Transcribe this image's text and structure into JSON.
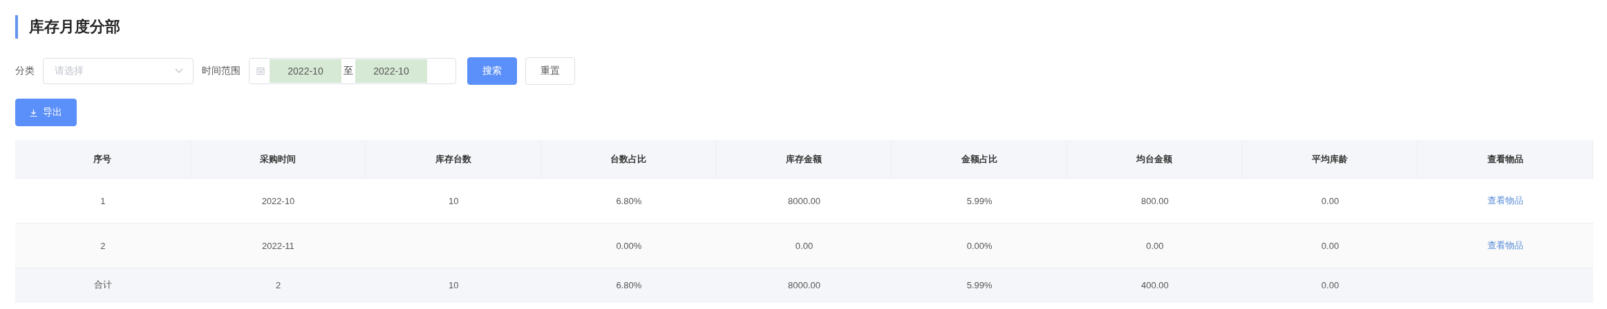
{
  "title": "库存月度分部",
  "filters": {
    "category_label": "分类",
    "category_placeholder": "请选择",
    "range_label": "时间范围",
    "range_start": "2022-10",
    "range_separator": "至",
    "range_end": "2022-10"
  },
  "buttons": {
    "search": "搜索",
    "reset": "重置",
    "export": "导出"
  },
  "table": {
    "columns": [
      "序号",
      "采购时间",
      "库存台数",
      "台数占比",
      "库存金额",
      "金额占比",
      "均台金额",
      "平均库龄",
      "查看物品"
    ],
    "rows": [
      {
        "kind": "data",
        "cells": [
          "1",
          "2022-10",
          "10",
          "6.80%",
          "8000.00",
          "5.99%",
          "800.00",
          "0.00"
        ],
        "link": "查看物品"
      },
      {
        "kind": "data",
        "cells": [
          "2",
          "2022-11",
          "",
          "0.00%",
          "0.00",
          "0.00%",
          "0.00",
          "0.00"
        ],
        "link": "查看物品"
      },
      {
        "kind": "total",
        "cells": [
          "合计",
          "2",
          "10",
          "6.80%",
          "8000.00",
          "5.99%",
          "400.00",
          "0.00"
        ]
      }
    ]
  }
}
